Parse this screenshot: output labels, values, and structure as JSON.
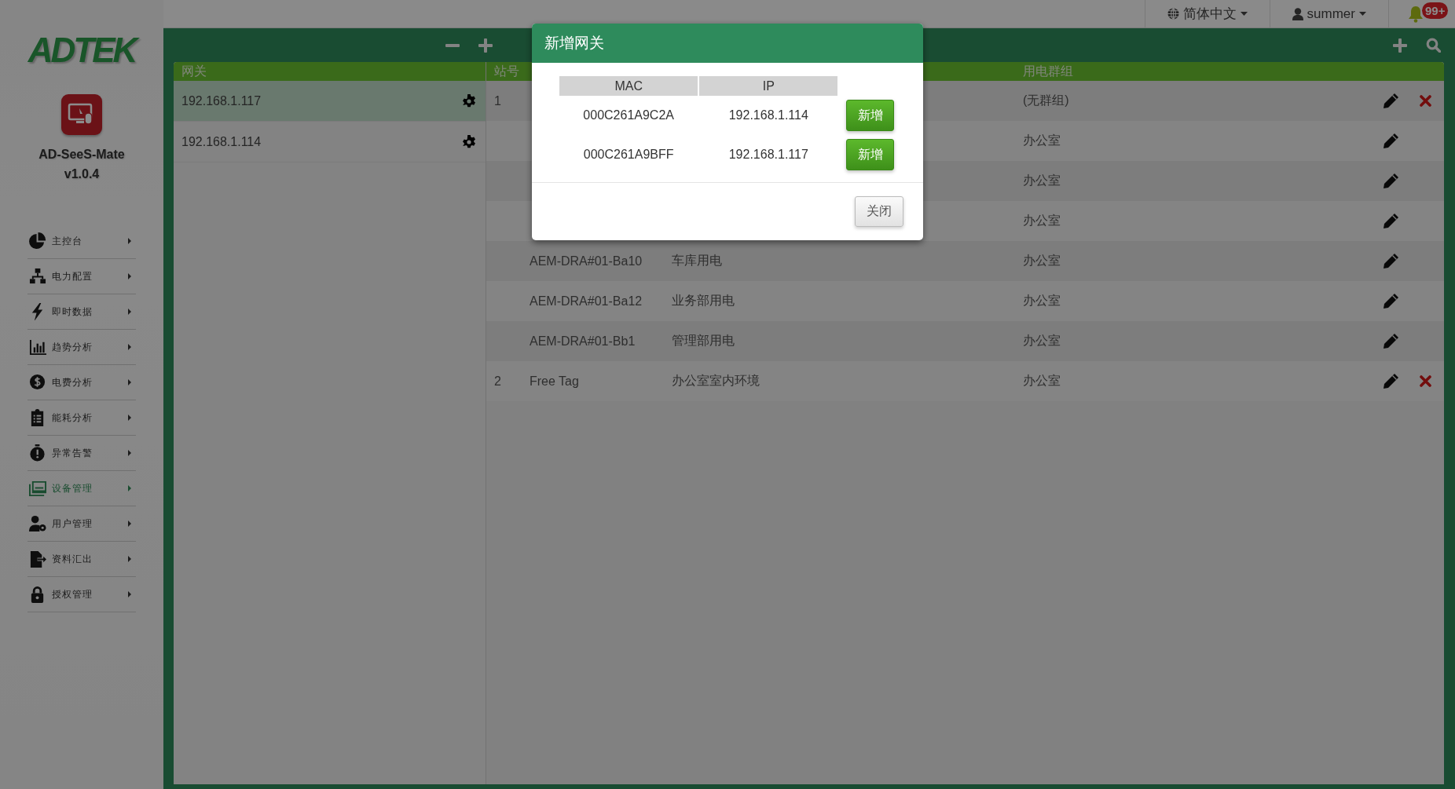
{
  "sidebar": {
    "logo": "ADTEK",
    "app_name": "AD-SeeS-Mate",
    "version": "v1.0.4",
    "items": [
      {
        "label": "主控台",
        "selected": false
      },
      {
        "label": "电力配置",
        "selected": false
      },
      {
        "label": "即时数据",
        "selected": false
      },
      {
        "label": "趋势分析",
        "selected": false
      },
      {
        "label": "电费分析",
        "selected": false
      },
      {
        "label": "能耗分析",
        "selected": false
      },
      {
        "label": "异常告警",
        "selected": false
      },
      {
        "label": "设备管理",
        "selected": true
      },
      {
        "label": "用户管理",
        "selected": false
      },
      {
        "label": "资料汇出",
        "selected": false
      },
      {
        "label": "授权管理",
        "selected": false
      }
    ]
  },
  "topbar": {
    "language": "简体中文",
    "user": "summer",
    "notifications": "99+"
  },
  "gateways": {
    "header": "网关",
    "items": [
      {
        "ip": "192.168.1.117",
        "selected": true
      },
      {
        "ip": "192.168.1.114",
        "selected": false
      }
    ]
  },
  "devices": {
    "station_header": "站号",
    "group_header": "用电群组",
    "rows": [
      {
        "station": "1",
        "group": "(无群组)",
        "deletable": true
      },
      {
        "group": "办公室",
        "deletable": false
      },
      {
        "group": "办公室",
        "deletable": false
      },
      {
        "group": "办公室",
        "deletable": false
      },
      {
        "device": "AEM-DRA#01-Ba10",
        "description": "车库用电",
        "group": "办公室",
        "deletable": false
      },
      {
        "device": "AEM-DRA#01-Ba12",
        "description": "业务部用电",
        "group": "办公室",
        "deletable": false
      },
      {
        "device": "AEM-DRA#01-Bb1",
        "description": "管理部用电",
        "group": "办公室",
        "deletable": false
      },
      {
        "station": "2",
        "device": "Free Tag",
        "description": "办公室室内环境",
        "group": "办公室",
        "deletable": true
      }
    ]
  },
  "modal": {
    "title": "新增网关",
    "columns": [
      "MAC",
      "IP"
    ],
    "rows": [
      {
        "mac": "000C261A9C2A",
        "ip": "192.168.1.114",
        "action": "新增"
      },
      {
        "mac": "000C261A9BFF",
        "ip": "192.168.1.117",
        "action": "新增"
      }
    ],
    "close": "关闭"
  }
}
